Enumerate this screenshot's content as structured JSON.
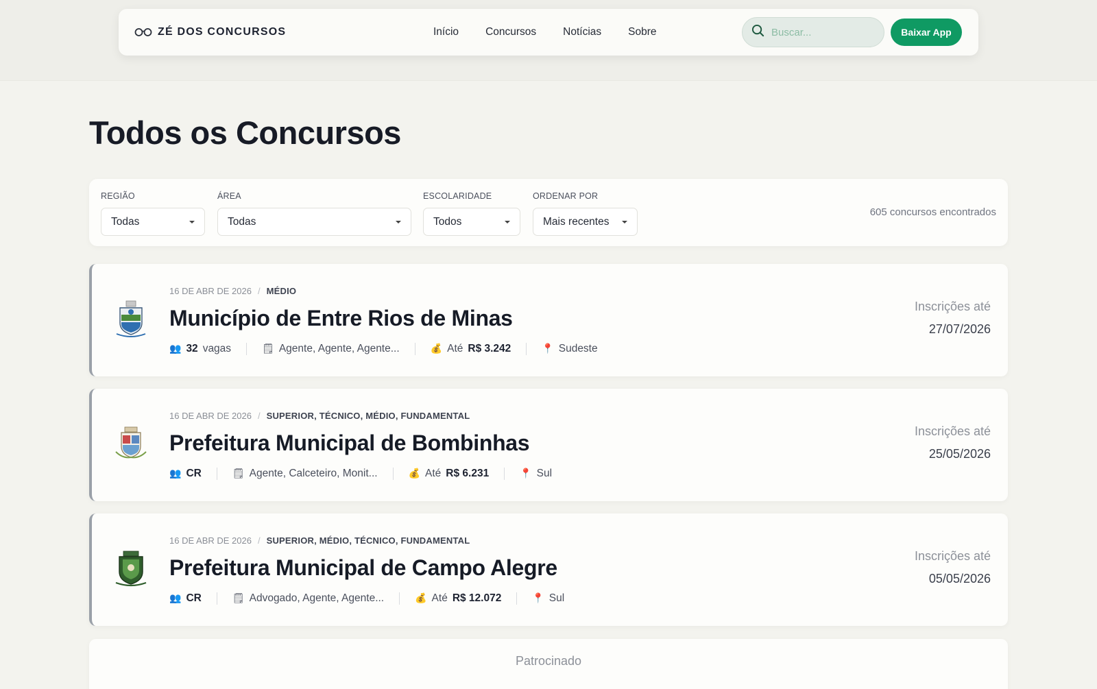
{
  "brand": {
    "name": "ZÉ DOS CONCURSOS",
    "logo": "glasses-icon"
  },
  "nav": {
    "links": [
      "Início",
      "Concursos",
      "Notícias",
      "Sobre"
    ]
  },
  "search": {
    "placeholder": "Buscar...",
    "icon": "search-icon",
    "value": ""
  },
  "cta": {
    "label": "Baixar App",
    "color": "#0f9a63"
  },
  "page": {
    "title": "Todos os Concursos"
  },
  "filters": {
    "regiao": {
      "label": "REGIÃO",
      "value": "Todas"
    },
    "area": {
      "label": "ÁREA",
      "value": "Todas"
    },
    "escolaridade": {
      "label": "ESCOLARIDADE",
      "value": "Todos"
    },
    "ordenar": {
      "label": "ORDENAR POR",
      "value": "Mais recentes"
    },
    "results_count": "605 concursos encontrados"
  },
  "contests": [
    {
      "date": "16 DE ABR DE 2026",
      "level": "MÉDIO",
      "title": "Município de Entre Rios de Minas",
      "vacancies": "32",
      "vacancies_suffix": "vagas",
      "positions": "Agente, Agente, Agente...",
      "salary_prefix": "Até",
      "salary": "R$ 3.242",
      "region": "Sudeste",
      "deadline_label": "Inscrições até",
      "deadline": "27/07/2026",
      "logo": "coat-of-arms-icon"
    },
    {
      "date": "16 DE ABR DE 2026",
      "level": "SUPERIOR, TÉCNICO, MÉDIO, FUNDAMENTAL",
      "title": "Prefeitura Municipal de Bombinhas",
      "vacancies": "CR",
      "vacancies_suffix": "",
      "positions": "Agente, Calceteiro, Monit...",
      "salary_prefix": "Até",
      "salary": "R$ 6.231",
      "region": "Sul",
      "deadline_label": "Inscrições até",
      "deadline": "25/05/2026",
      "logo": "coat-of-arms-icon"
    },
    {
      "date": "16 DE ABR DE 2026",
      "level": "SUPERIOR, MÉDIO, TÉCNICO, FUNDAMENTAL",
      "title": "Prefeitura Municipal de Campo Alegre",
      "vacancies": "CR",
      "vacancies_suffix": "",
      "positions": "Advogado, Agente, Agente...",
      "salary_prefix": "Até",
      "salary": "R$ 12.072",
      "region": "Sul",
      "deadline_label": "Inscrições até",
      "deadline": "05/05/2026",
      "logo": "coat-of-arms-icon"
    }
  ],
  "sponsored": {
    "label": "Patrocinado"
  }
}
